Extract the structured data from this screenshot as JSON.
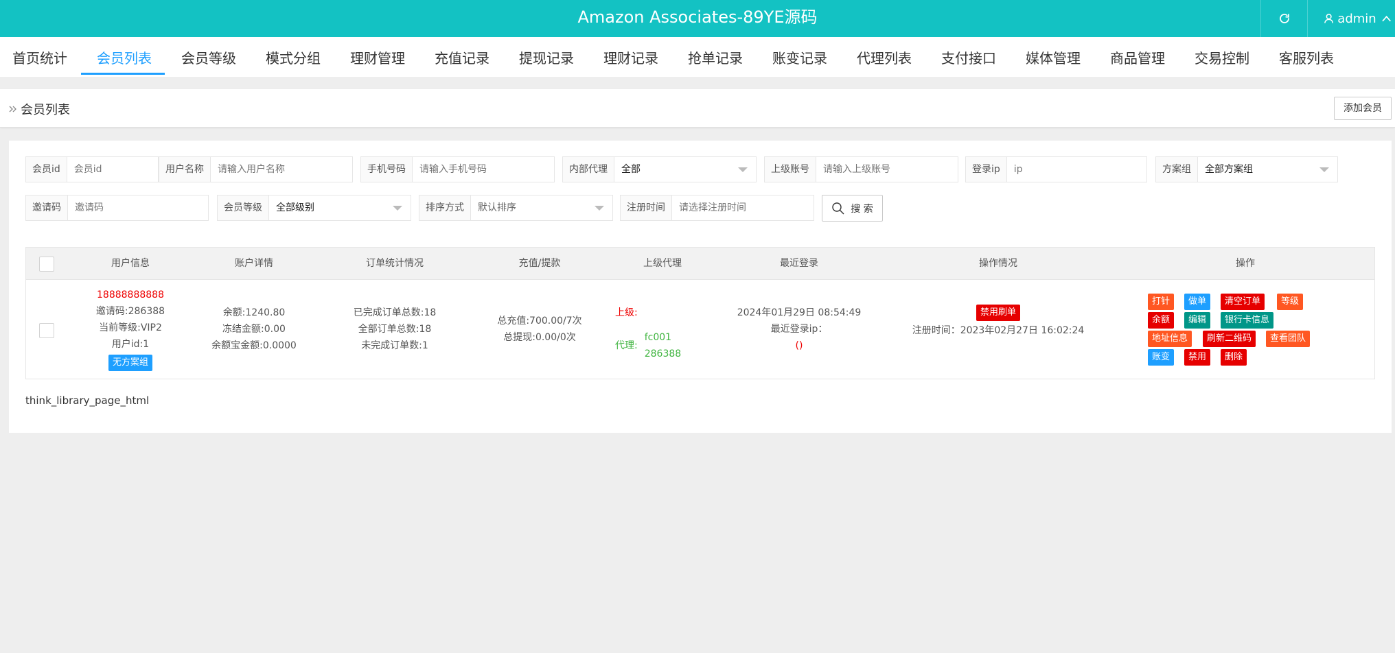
{
  "header": {
    "title": "Amazon Associates-89YE源码",
    "user": "admin"
  },
  "nav": {
    "tabs": [
      "首页统计",
      "会员列表",
      "会员等级",
      "模式分组",
      "理财管理",
      "充值记录",
      "提现记录",
      "理财记录",
      "抢单记录",
      "账变记录",
      "代理列表",
      "支付接口",
      "媒体管理",
      "商品管理",
      "交易控制",
      "客服列表"
    ],
    "active": "会员列表"
  },
  "breadcrumb": {
    "current": "会员列表",
    "add_button": "添加会员"
  },
  "filters": {
    "member_id": {
      "label": "会员id",
      "placeholder": "会员id"
    },
    "username": {
      "label": "用户名称",
      "placeholder": "请输入用户名称"
    },
    "phone": {
      "label": "手机号码",
      "placeholder": "请输入手机号码"
    },
    "internal_agent": {
      "label": "内部代理",
      "value": "全部"
    },
    "superior_account": {
      "label": "上级账号",
      "placeholder": "请输入上级账号"
    },
    "login_ip": {
      "label": "登录ip",
      "placeholder": "ip"
    },
    "plan_group": {
      "label": "方案组",
      "value": "全部方案组"
    },
    "invite_code": {
      "label": "邀请码",
      "placeholder": "邀请码"
    },
    "member_level": {
      "label": "会员等级",
      "value": "全部级别"
    },
    "sort": {
      "label": "排序方式",
      "value": "默认排序"
    },
    "register_time": {
      "label": "注册时间",
      "placeholder": "请选择注册时间"
    },
    "search_button": "搜 索"
  },
  "table": {
    "headers": [
      "用户信息",
      "账户详情",
      "订单统计情况",
      "充值/提款",
      "上级代理",
      "最近登录",
      "操作情况",
      "操作"
    ],
    "rows": [
      {
        "phone": "18888888888",
        "invite_code": "邀请码:286388",
        "level": "当前等级:VIP2",
        "user_id": "用户id:1",
        "plan_badge": "无方案组",
        "balance": "余额:1240.80",
        "frozen": "冻结金额:0.00",
        "yuebao": "余额宝金额:0.0000",
        "orders_done": "已完成订单总数:18",
        "orders_total": "全部订单总数:18",
        "orders_pending": "未完成订单数:1",
        "recharge": "总充值:700.00/7次",
        "withdraw": "总提现:0.00/0次",
        "superior_label": "上级:",
        "agent_label": "代理:",
        "agent_name": "fc001",
        "agent_code": "286388",
        "last_login": "2024年01月29日 08:54:49",
        "last_ip_label": "最近登录ip：",
        "last_ip_value": "()",
        "ban_badge": "禁用刷单",
        "register_time": "注册时间：2023年02月27日 16:02:24",
        "actions": [
          "打针",
          "做单",
          "清空订单",
          "等级",
          "余额",
          "编辑",
          "银行卡信息",
          "地址信息",
          "刷新二维码",
          "查看团队",
          "账变",
          "禁用",
          "删除"
        ]
      }
    ]
  },
  "footer_text": "think_library_page_html",
  "colors": {
    "header": "#13c2c3",
    "active_tab": "#1e9fff",
    "blue": "#1e9fff",
    "red": "#e60000",
    "orange": "#ff5722",
    "green": "#009688"
  }
}
